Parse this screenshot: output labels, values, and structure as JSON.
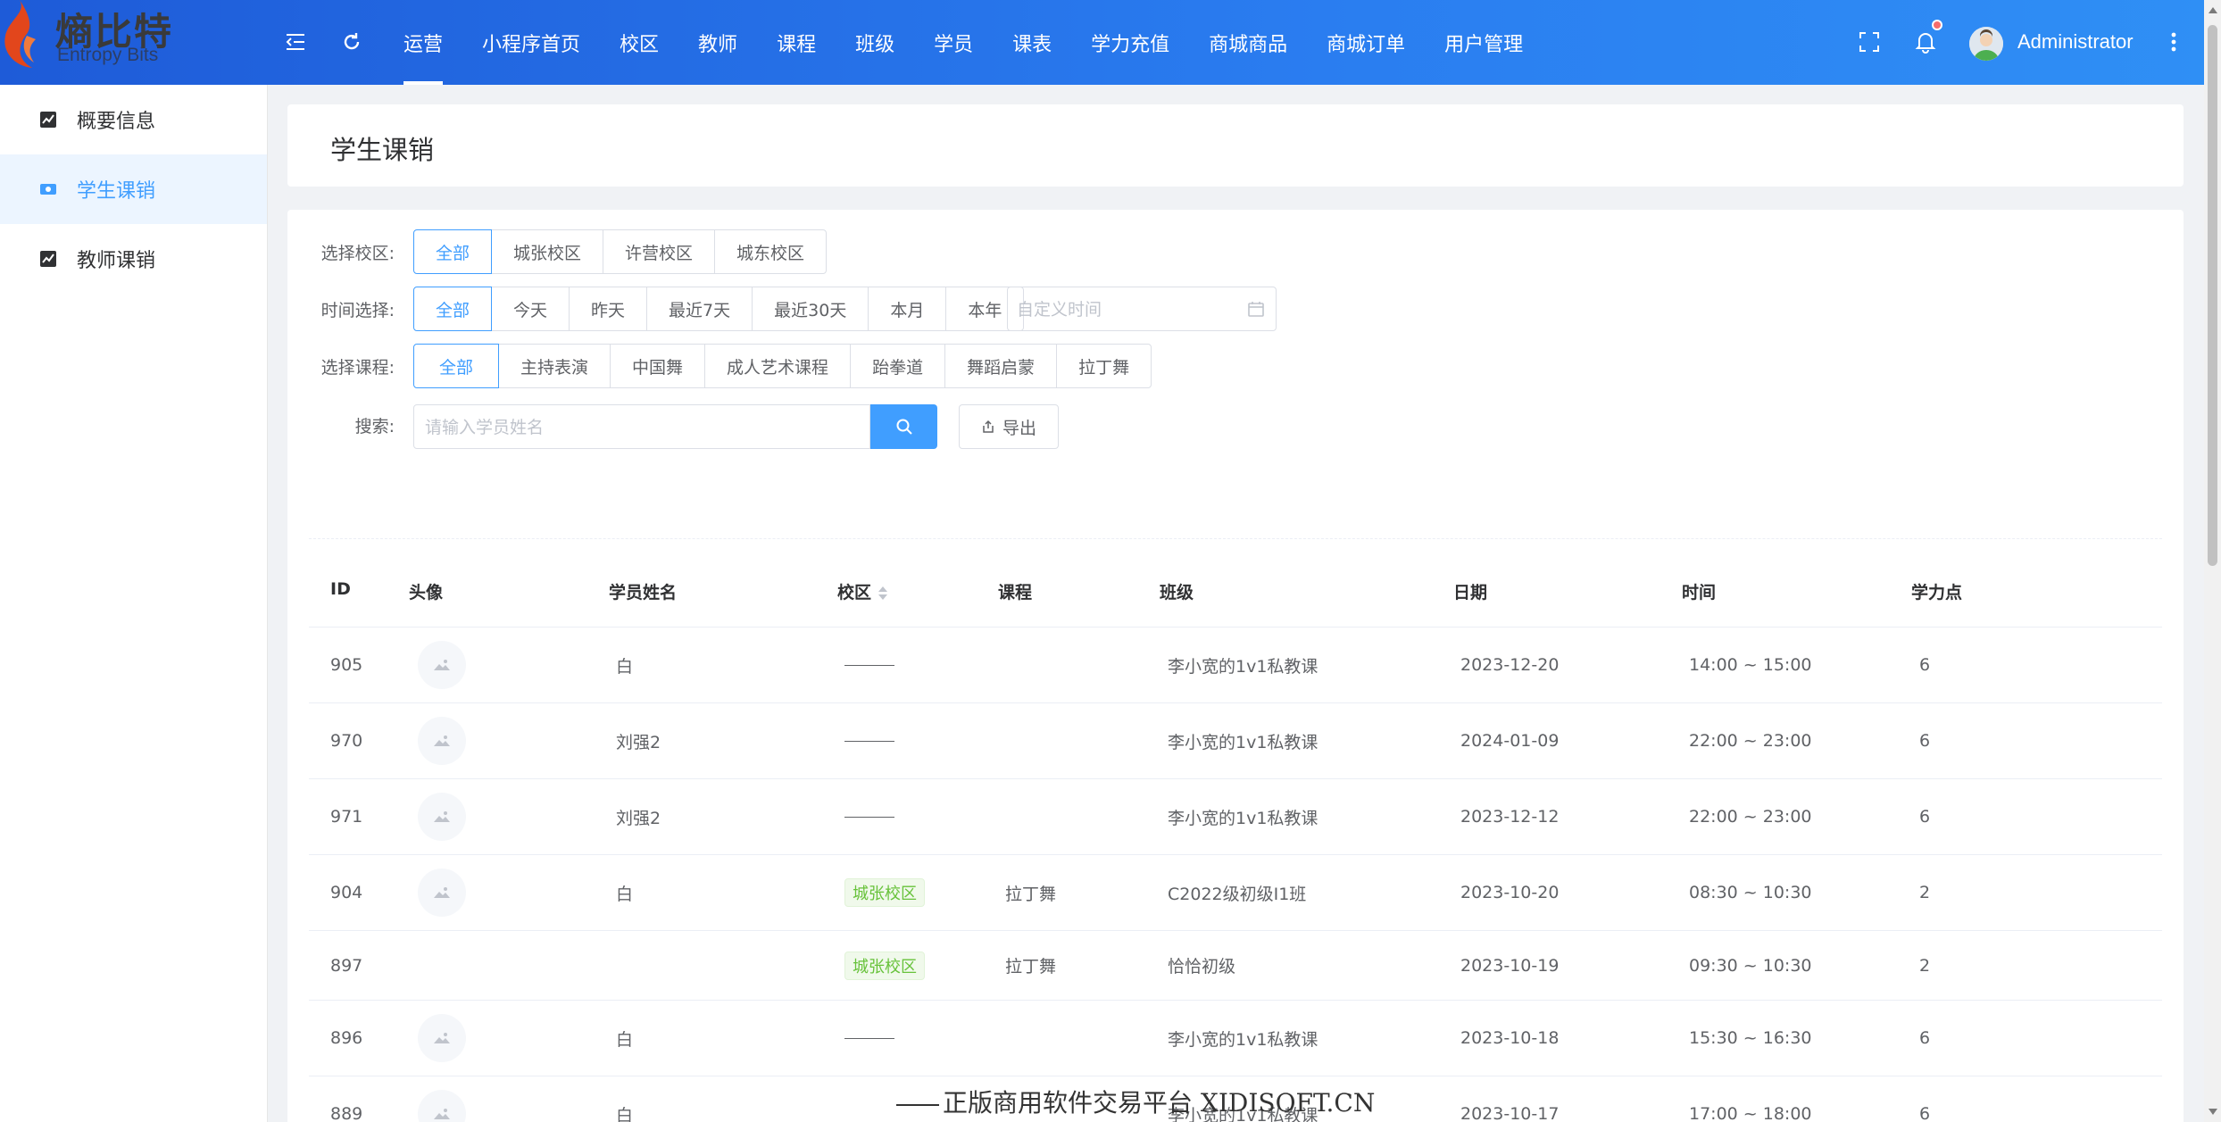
{
  "brand": {
    "name_cn": "熵比特",
    "name_en": "Entropy Bits"
  },
  "nav": {
    "items": [
      {
        "label": "运营",
        "active": true
      },
      {
        "label": "小程序首页"
      },
      {
        "label": "校区"
      },
      {
        "label": "教师"
      },
      {
        "label": "课程"
      },
      {
        "label": "班级"
      },
      {
        "label": "学员"
      },
      {
        "label": "课表"
      },
      {
        "label": "学力充值"
      },
      {
        "label": "商城商品"
      },
      {
        "label": "商城订单"
      },
      {
        "label": "用户管理"
      }
    ],
    "user": "Administrator",
    "accent": "#409eff",
    "topbar_gradient": [
      "#1e5bd8",
      "#2f8ff5"
    ]
  },
  "sidebar": {
    "items": [
      {
        "label": "概要信息",
        "icon": "chart-icon"
      },
      {
        "label": "学生课销",
        "icon": "card-icon",
        "active": true
      },
      {
        "label": "教师课销",
        "icon": "chart-icon"
      }
    ]
  },
  "page": {
    "title": "学生课销"
  },
  "filters": {
    "campus_label": "选择校区:",
    "campus_options": [
      "全部",
      "城张校区",
      "许营校区",
      "城东校区"
    ],
    "time_label": "时间选择:",
    "time_options": [
      "全部",
      "今天",
      "昨天",
      "最近7天",
      "最近30天",
      "本月",
      "本年"
    ],
    "date_placeholder": "自定义时间",
    "course_label": "选择课程:",
    "course_options": [
      "全部",
      "主持表演",
      "中国舞",
      "成人艺术课程",
      "跆拳道",
      "舞蹈启蒙",
      "拉丁舞"
    ],
    "search_label": "搜索:",
    "search_placeholder": "请输入学员姓名",
    "export_label": "导出"
  },
  "table": {
    "columns": [
      "ID",
      "头像",
      "学员姓名",
      "校区",
      "课程",
      "班级",
      "日期",
      "时间",
      "学力点"
    ],
    "rows": [
      {
        "id": "905",
        "name": "白",
        "campus": "",
        "course": "",
        "class": "李小宽的1v1私教课",
        "date": "2023-12-20",
        "time": "14:00 ~ 15:00",
        "points": "6"
      },
      {
        "id": "970",
        "name": "刘强2",
        "campus": "",
        "course": "",
        "class": "李小宽的1v1私教课",
        "date": "2024-01-09",
        "time": "22:00 ~ 23:00",
        "points": "6"
      },
      {
        "id": "971",
        "name": "刘强2",
        "campus": "",
        "course": "",
        "class": "李小宽的1v1私教课",
        "date": "2023-12-12",
        "time": "22:00 ~ 23:00",
        "points": "6"
      },
      {
        "id": "904",
        "name": "白",
        "campus": "城张校区",
        "course": "拉丁舞",
        "class": "C2022级初级I1班",
        "date": "2023-10-20",
        "time": "08:30 ~ 10:30",
        "points": "2"
      },
      {
        "id": "897",
        "name": "",
        "campus": "城张校区",
        "course": "拉丁舞",
        "class": "恰恰初级",
        "date": "2023-10-19",
        "time": "09:30 ~ 10:30",
        "points": "2"
      },
      {
        "id": "896",
        "name": "白",
        "campus": "",
        "course": "",
        "class": "李小宽的1v1私教课",
        "date": "2023-10-18",
        "time": "15:30 ~ 16:30",
        "points": "6"
      },
      {
        "id": "889",
        "name": "白",
        "campus": "",
        "course": "",
        "class": "李小宽的1v1私教课",
        "date": "2023-10-17",
        "time": "17:00 ~ 18:00",
        "points": "6"
      }
    ]
  },
  "watermark": "正版商用软件交易平台 XIDISOFT.CN"
}
